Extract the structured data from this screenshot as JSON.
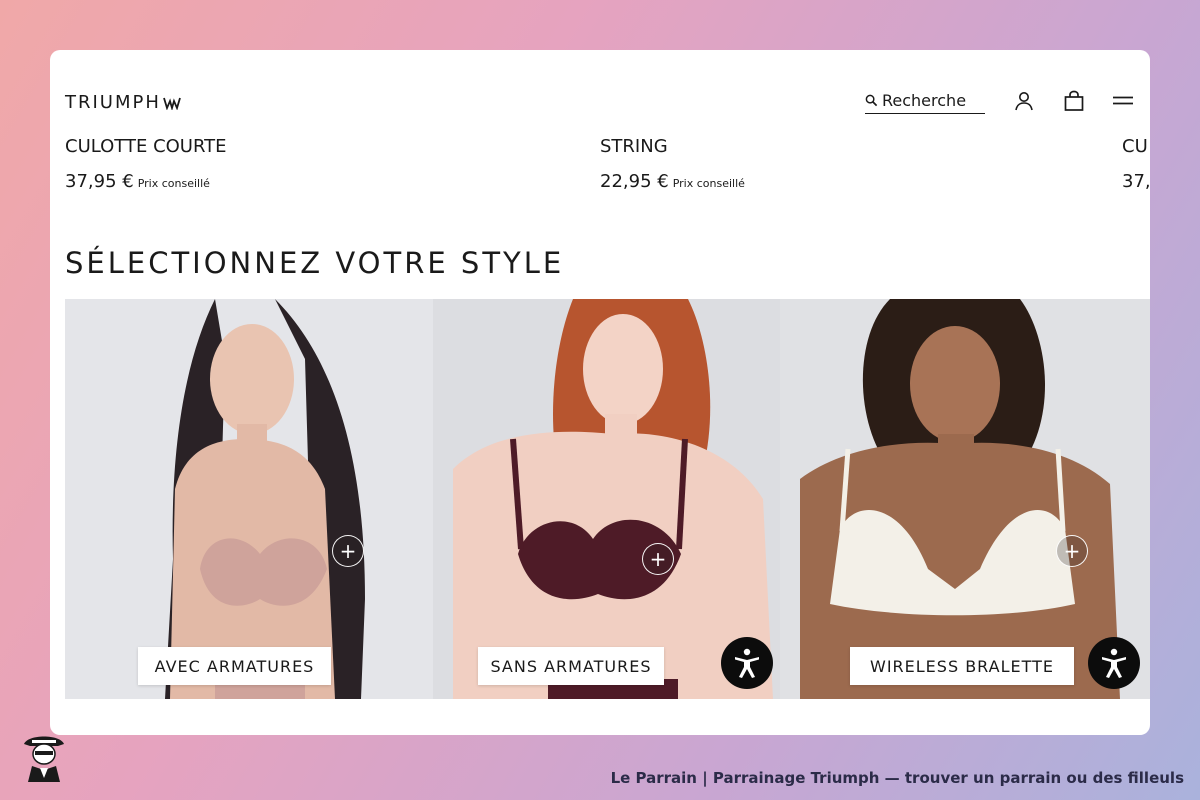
{
  "header": {
    "logo_text": "TRIUMPH",
    "search_placeholder": "Recherche",
    "icons": [
      "search-icon",
      "account-icon",
      "bag-icon",
      "menu-icon"
    ]
  },
  "products": [
    {
      "name": "CULOTTE COURTE",
      "price": "37,95 €",
      "note": "Prix conseillé"
    },
    {
      "name": "STRING",
      "price": "22,95 €",
      "note": "Prix conseillé"
    },
    {
      "name": "CU",
      "price": "37,",
      "note": ""
    }
  ],
  "section": {
    "title": "SÉLECTIONNEZ VOTRE STYLE"
  },
  "styles": [
    {
      "label": "AVEC ARMATURES",
      "plus": "+"
    },
    {
      "label": "SANS ARMATURES",
      "plus": "+"
    },
    {
      "label": "WIRELESS BRALETTE",
      "plus": "+"
    }
  ],
  "footer": {
    "caption": "Le Parrain | Parrainage Triumph — trouver un parrain ou des filleuls"
  },
  "colors": {
    "text": "#1a1a1a",
    "card": "#ffffff",
    "accessibility_button": "#0c0c0c"
  }
}
